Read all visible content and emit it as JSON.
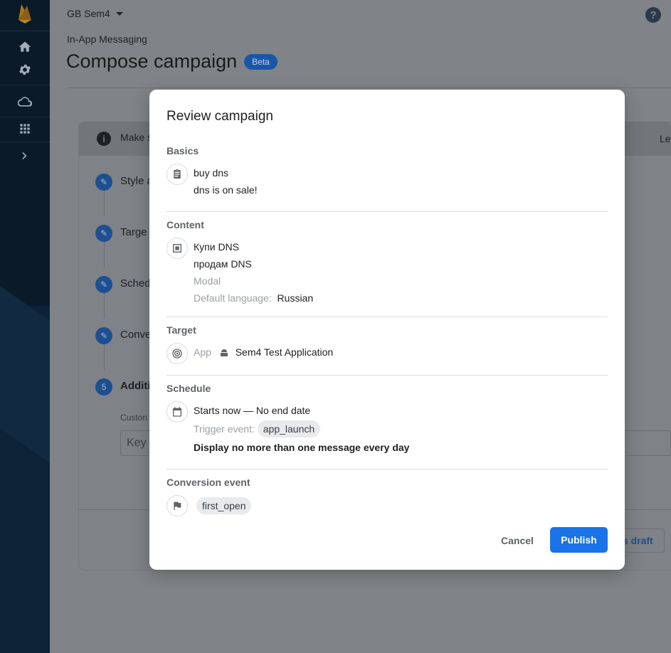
{
  "topbar": {
    "project": "GB Sem4",
    "help_glyph": "?"
  },
  "breadcrumb": "In-App Messaging",
  "page": {
    "title": "Compose campaign",
    "badge": "Beta"
  },
  "background": {
    "info_text": "Make s",
    "info_right": "Le",
    "steps": [
      {
        "label": "Style a"
      },
      {
        "label": "Targe"
      },
      {
        "label": "Sched"
      },
      {
        "label": "Conve"
      },
      {
        "label": "Additi",
        "number": "5"
      }
    ],
    "custom_label": "Custon",
    "key_placeholder": "Key",
    "draft_label": "s draft"
  },
  "modal": {
    "title": "Review campaign",
    "basics": {
      "heading": "Basics",
      "title": "buy dns",
      "body": "dns is on sale!"
    },
    "content": {
      "heading": "Content",
      "title": "Купи DNS",
      "body": "продам DNS",
      "layout": "Modal",
      "lang_label": "Default language:",
      "lang_value": "Russian"
    },
    "target": {
      "heading": "Target",
      "app_label": "App",
      "app_name": "Sem4 Test Application"
    },
    "schedule": {
      "heading": "Schedule",
      "range": "Starts now — No end date",
      "trigger_label": "Trigger event:",
      "trigger_value": "app_launch",
      "frequency": "Display no more than one message every day"
    },
    "conversion": {
      "heading": "Conversion event",
      "event": "first_open"
    },
    "actions": {
      "cancel": "Cancel",
      "publish": "Publish"
    }
  },
  "colors": {
    "primary": "#1a73e8",
    "sidebar": "#0b1a28",
    "scrim_bg": "#808388"
  }
}
